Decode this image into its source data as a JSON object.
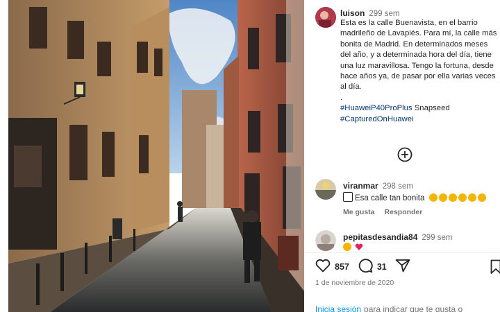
{
  "post": {
    "username": "luison",
    "time": "299 sem",
    "caption": [
      "Esta es la calle Buenavista, en el barrio madrileño de Lavapiés. Para mí, la calle más bonita de Madrid. En determinados meses del año, y a determinada hora del día, tiene una luz maravillosa. Tengo la fortuna, desde hace años ya, de pasar por ella varias veces al día.",
      "."
    ],
    "hashtag_line_1": "#HuaweiP40ProPlus",
    "hashtag_line_1_extra": "Snapseed",
    "hashtag_line_2": "#CapturedOnHuawei",
    "likes": "857",
    "comments_count": "31",
    "date": "1 de noviembre de 2020"
  },
  "comments": [
    {
      "username": "viranmar",
      "time": "298 sem",
      "text": "Esa calle tan bonita",
      "like_label": "Me gusta",
      "reply_label": "Responder"
    },
    {
      "username": "pepitasdesandia84",
      "time": "299 sem"
    }
  ],
  "footer": {
    "login_link": "Inicia sesión",
    "login_text": "para indicar que te gusta o"
  },
  "icons": {
    "add": "plus-circle-icon",
    "like": "heart-icon",
    "comment": "comment-icon",
    "share": "send-icon",
    "save": "bookmark-icon"
  },
  "colors": {
    "link": "#00376b",
    "login_link": "#0095f6",
    "secondary_text": "#737373"
  }
}
